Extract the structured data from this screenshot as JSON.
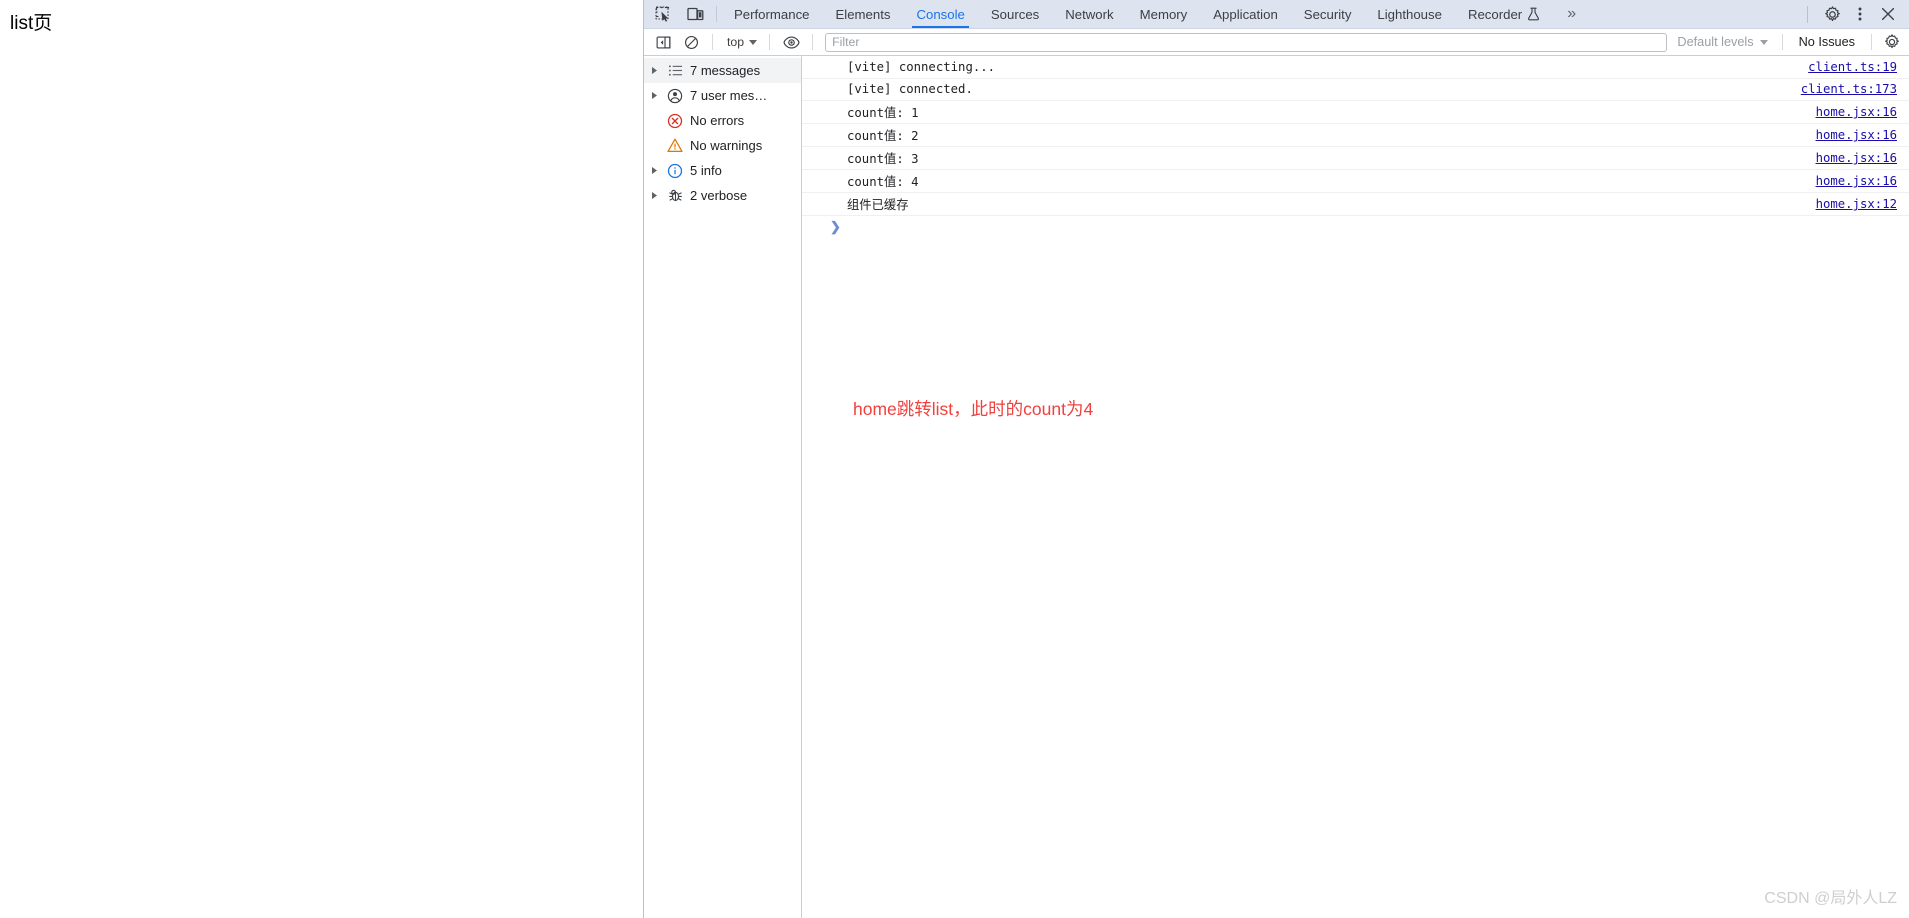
{
  "page": {
    "title": "list页"
  },
  "devtools": {
    "tabstrip": {
      "icons": [
        {
          "name": "inspect-element-icon",
          "glyph": "inspect"
        },
        {
          "name": "device-toolbar-icon",
          "glyph": "device"
        }
      ],
      "tabs": [
        {
          "label": "Performance",
          "selected": false,
          "icon": ""
        },
        {
          "label": "Elements",
          "selected": false,
          "icon": ""
        },
        {
          "label": "Console",
          "selected": true,
          "icon": ""
        },
        {
          "label": "Sources",
          "selected": false,
          "icon": ""
        },
        {
          "label": "Network",
          "selected": false,
          "icon": ""
        },
        {
          "label": "Memory",
          "selected": false,
          "icon": ""
        },
        {
          "label": "Application",
          "selected": false,
          "icon": ""
        },
        {
          "label": "Security",
          "selected": false,
          "icon": ""
        },
        {
          "label": "Lighthouse",
          "selected": false,
          "icon": ""
        },
        {
          "label": "Recorder",
          "selected": false,
          "icon": "flask"
        }
      ],
      "more_label": "»",
      "right_buttons": [
        {
          "name": "settings-gear-button",
          "label": "settings"
        },
        {
          "name": "more-options-button",
          "label": "more"
        },
        {
          "name": "close-devtools-button",
          "label": "close"
        }
      ]
    },
    "console_toolbar": {
      "clear_console_title": "Clear console",
      "sidebar_toggle_title": "Show console sidebar",
      "context_selector": "top",
      "eye_title": "Create live expression",
      "filter_placeholder": "Filter",
      "filter_value": "",
      "levels_label": "Default levels",
      "issues_label": "No Issues",
      "settings_title": "Console settings"
    },
    "sidebar": {
      "items": [
        {
          "label": "7 messages",
          "icon": "list-icon",
          "expandable": true,
          "selected": true
        },
        {
          "label": "7 user mes…",
          "icon": "user-icon",
          "expandable": true,
          "selected": false
        },
        {
          "label": "No errors",
          "icon": "error-icon",
          "expandable": false,
          "selected": false
        },
        {
          "label": "No warnings",
          "icon": "warning-icon",
          "expandable": false,
          "selected": false
        },
        {
          "label": "5 info",
          "icon": "info-icon",
          "expandable": true,
          "selected": false
        },
        {
          "label": "2 verbose",
          "icon": "bug-icon",
          "expandable": true,
          "selected": false
        }
      ]
    },
    "console_messages": [
      {
        "text": "[vite] connecting...",
        "source": "client.ts:19"
      },
      {
        "text": "[vite] connected.",
        "source": "client.ts:173"
      },
      {
        "text": "count值: 1",
        "source": "home.jsx:16"
      },
      {
        "text": "count值: 2",
        "source": "home.jsx:16"
      },
      {
        "text": "count值: 3",
        "source": "home.jsx:16"
      },
      {
        "text": "count值: 4",
        "source": "home.jsx:16"
      },
      {
        "text": "组件已缓存",
        "source": "home.jsx:12"
      }
    ],
    "prompt": {
      "caret": "❯"
    },
    "annotation": "home跳转list，此时的count为4"
  },
  "watermark": "CSDN @局外人LZ",
  "colors": {
    "accent": "#1a73e8",
    "tabstrip_bg": "#dee3f0",
    "annotation": "#f0413f",
    "link": "#1a0dab",
    "error": "#d93025",
    "warning": "#e37400"
  }
}
